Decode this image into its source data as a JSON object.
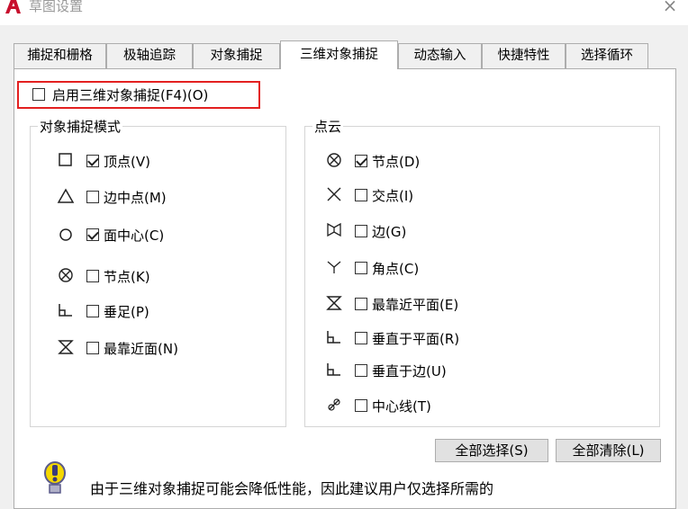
{
  "window": {
    "title": "草图设置",
    "close_glyph": "×"
  },
  "tabs": [
    {
      "label": "捕捉和栅格",
      "active": false
    },
    {
      "label": "极轴追踪",
      "active": false
    },
    {
      "label": "对象捕捉",
      "active": false
    },
    {
      "label": "三维对象捕捉",
      "active": true
    },
    {
      "label": "动态输入",
      "active": false
    },
    {
      "label": "快捷特性",
      "active": false
    },
    {
      "label": "选择循环",
      "active": false
    }
  ],
  "enable": {
    "label": "启用三维对象捕捉(F4)(O)",
    "checked": false
  },
  "snap_modes": {
    "title": "对象捕捉模式",
    "items": [
      {
        "label": "顶点(V)",
        "checked": true,
        "icon": "square-marker-icon"
      },
      {
        "label": "边中点(M)",
        "checked": false,
        "icon": "triangle-marker-icon"
      },
      {
        "label": "面中心(C)",
        "checked": true,
        "icon": "circle-marker-icon"
      },
      {
        "label": "节点(K)",
        "checked": false,
        "icon": "node-marker-icon"
      },
      {
        "label": "垂足(P)",
        "checked": false,
        "icon": "perpendicular-marker-icon"
      },
      {
        "label": "最靠近面(N)",
        "checked": false,
        "icon": "nearest-marker-icon"
      }
    ]
  },
  "point_cloud": {
    "title": "点云",
    "items": [
      {
        "label": "节点(D)",
        "checked": true,
        "icon": "node-marker-icon"
      },
      {
        "label": "交点(I)",
        "checked": false,
        "icon": "intersection-marker-icon"
      },
      {
        "label": "边(G)",
        "checked": false,
        "icon": "edge-marker-icon"
      },
      {
        "label": "角点(C)",
        "checked": false,
        "icon": "corner-marker-icon"
      },
      {
        "label": "最靠近平面(E)",
        "checked": false,
        "icon": "nearest-plane-marker-icon"
      },
      {
        "label": "垂直于平面(R)",
        "checked": false,
        "icon": "perpendicular-marker-icon"
      },
      {
        "label": "垂直于边(U)",
        "checked": false,
        "icon": "perpendicular-marker-icon"
      },
      {
        "label": "中心线(T)",
        "checked": false,
        "icon": "centerline-marker-icon"
      }
    ]
  },
  "buttons": {
    "select_all": "全部选择(S)",
    "clear_all": "全部清除(L)"
  },
  "info": {
    "text": "由于三维对象捕捉可能会降低性能，因此建议用户仅选择所需的"
  },
  "colors": {
    "highlight": "#e32020",
    "app_icon": "#c8102e",
    "info_icon": "#f5d800"
  }
}
